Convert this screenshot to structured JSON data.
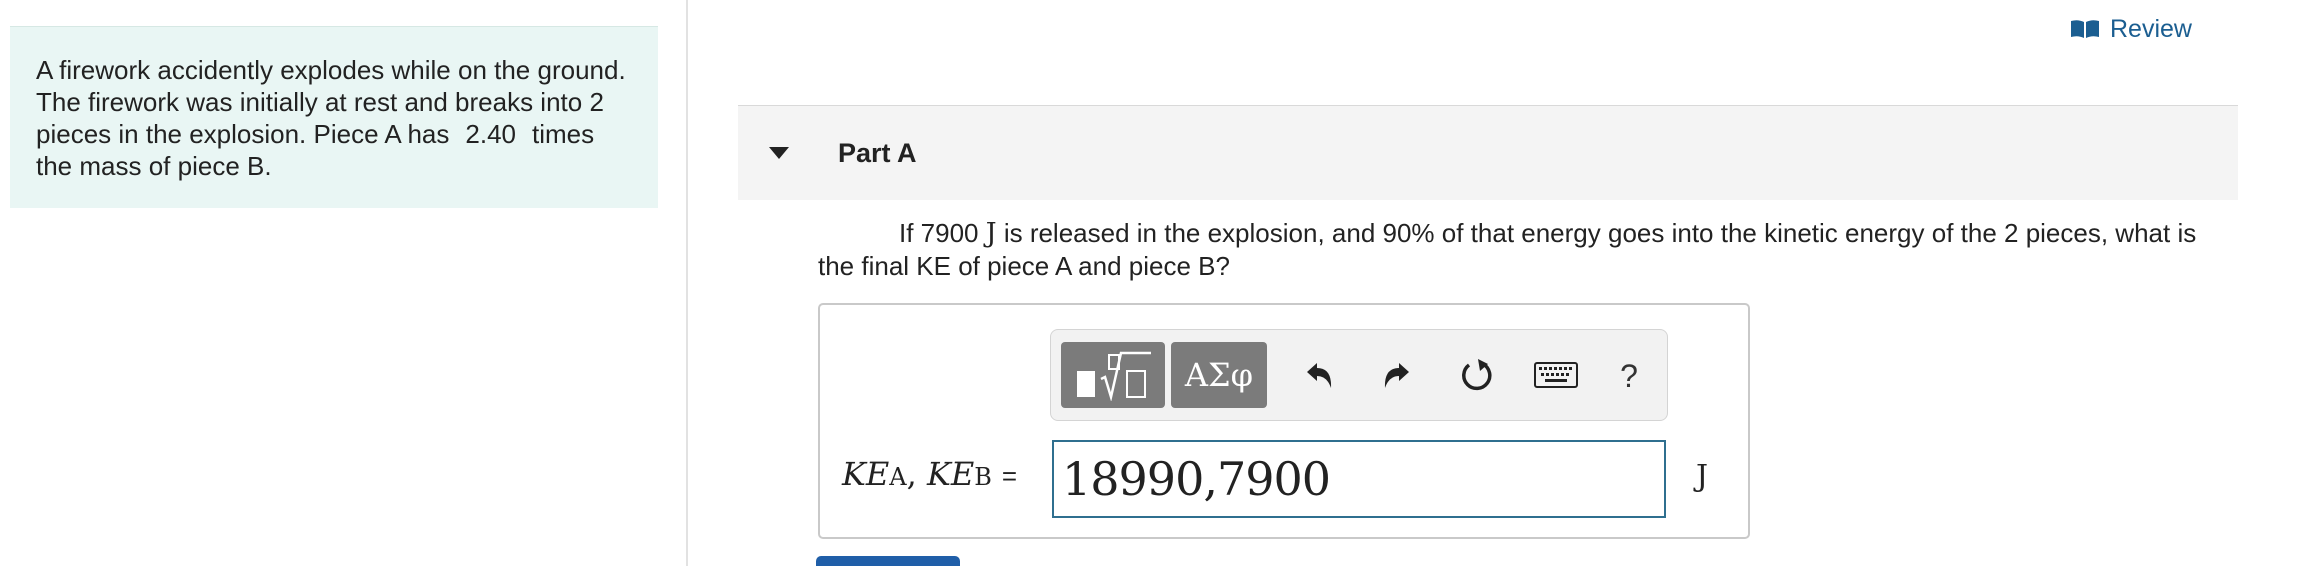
{
  "problem": {
    "text_before": "A firework accidently explodes while on the ground. The firework was initially at rest and breaks into 2 pieces in the explosion. Piece A has",
    "mass_ratio": "2.40",
    "text_after": "times the mass of piece B."
  },
  "review": {
    "label": "Review",
    "icon": "book-icon",
    "color": "#1b5e91"
  },
  "part": {
    "title": "Part A",
    "icon": "caret-down-icon"
  },
  "question": {
    "prefix": "If 7900",
    "energy_unit": "J",
    "suffix": "is released in the explosion, and 90% of that energy goes into the kinetic energy of the 2 pieces, what is the final KE of piece A and piece B?"
  },
  "toolbar": {
    "templates_icon": "templates-icon",
    "greek_label": "ΑΣφ",
    "undo_icon": "undo-icon",
    "redo_icon": "redo-icon",
    "reset_icon": "reset-icon",
    "keyboard_icon": "keyboard-icon",
    "help_label": "?"
  },
  "answer": {
    "label_ke1": "KE",
    "label_sub1": "A",
    "separator": ",",
    "label_ke2": "KE",
    "label_sub2": "B",
    "equals": "=",
    "value": "18990,7900",
    "unit": "J"
  },
  "colors": {
    "problem_bg": "#e9f6f4",
    "input_border": "#2f6f8f",
    "toolbar_btn": "#7b7b7b",
    "submit": "#1f5ea8"
  }
}
